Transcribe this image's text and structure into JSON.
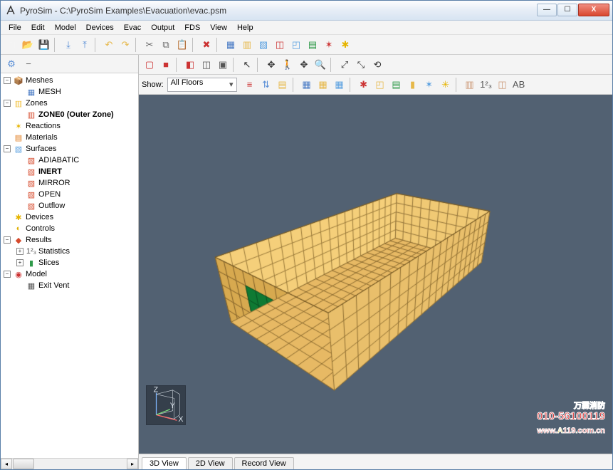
{
  "window": {
    "title": "PyroSim - C:\\PyroSim Examples\\Evacuation\\evac.psm",
    "buttons": {
      "min": "—",
      "max": "☐",
      "close": "X"
    }
  },
  "menu": [
    "File",
    "Edit",
    "Model",
    "Devices",
    "Evac",
    "Output",
    "FDS",
    "View",
    "Help"
  ],
  "toolbar_main": [
    {
      "name": "new-icon"
    },
    {
      "name": "open-icon"
    },
    {
      "name": "save-icon"
    },
    {
      "sep": true
    },
    {
      "name": "import-icon"
    },
    {
      "name": "export-icon"
    },
    {
      "sep": true
    },
    {
      "name": "undo-icon"
    },
    {
      "name": "redo-icon"
    },
    {
      "sep": true
    },
    {
      "name": "cut-icon"
    },
    {
      "name": "copy-icon"
    },
    {
      "name": "paste-icon"
    },
    {
      "sep": true
    },
    {
      "name": "delete-icon"
    },
    {
      "sep": true
    },
    {
      "name": "new-mesh-icon"
    },
    {
      "name": "new-zone-icon"
    },
    {
      "name": "new-surface-icon"
    },
    {
      "name": "new-obstruction-icon"
    },
    {
      "name": "new-hole-icon"
    },
    {
      "name": "new-vent-icon"
    },
    {
      "name": "new-particle-icon"
    },
    {
      "name": "new-device-icon"
    }
  ],
  "leftpane_toolbar": [
    {
      "name": "settings-icon"
    },
    {
      "name": "collapse-icon"
    }
  ],
  "tree": [
    {
      "depth": 0,
      "exp": "-",
      "icon": "📦",
      "color": "#4b7cc5",
      "label": "Meshes"
    },
    {
      "depth": 1,
      "exp": "",
      "icon": "▦",
      "color": "#4b7cc5",
      "label": "MESH"
    },
    {
      "depth": 0,
      "exp": "-",
      "icon": "▥",
      "color": "#f2c241",
      "label": "Zones"
    },
    {
      "depth": 1,
      "exp": "",
      "icon": "▥",
      "color": "#d64a2c",
      "label": "ZONE0 (Outer Zone)",
      "bold": true
    },
    {
      "depth": 0,
      "exp": "",
      "icon": "✶",
      "color": "#e6b400",
      "label": "Reactions"
    },
    {
      "depth": 0,
      "exp": "",
      "icon": "▤",
      "color": "#e07a1b",
      "label": "Materials"
    },
    {
      "depth": 0,
      "exp": "-",
      "icon": "▧",
      "color": "#5aa0e0",
      "label": "Surfaces"
    },
    {
      "depth": 1,
      "exp": "",
      "icon": "▧",
      "color": "#d64a2c",
      "label": "ADIABATIC"
    },
    {
      "depth": 1,
      "exp": "",
      "icon": "▧",
      "color": "#d64a2c",
      "label": "INERT",
      "bold": true
    },
    {
      "depth": 1,
      "exp": "",
      "icon": "▧",
      "color": "#d64a2c",
      "label": "MIRROR"
    },
    {
      "depth": 1,
      "exp": "",
      "icon": "▧",
      "color": "#d64a2c",
      "label": "OPEN"
    },
    {
      "depth": 1,
      "exp": "",
      "icon": "▧",
      "color": "#d64a2c",
      "label": "Outflow"
    },
    {
      "depth": 0,
      "exp": "",
      "icon": "✱",
      "color": "#e6b400",
      "label": "Devices"
    },
    {
      "depth": 0,
      "exp": "",
      "icon": "◐",
      "color": "#e0b000",
      "label": "Controls"
    },
    {
      "depth": 0,
      "exp": "-",
      "icon": "◆",
      "color": "#d64a2c",
      "label": "Results"
    },
    {
      "depth": 1,
      "exp": "+",
      "icon": "1²₃",
      "color": "#555",
      "label": "Statistics"
    },
    {
      "depth": 1,
      "exp": "+",
      "icon": "▮",
      "color": "#2f9a4a",
      "label": "Slices"
    },
    {
      "depth": 0,
      "exp": "-",
      "icon": "◉",
      "color": "#c33",
      "label": "Model"
    },
    {
      "depth": 1,
      "exp": "",
      "icon": "▦",
      "color": "#555",
      "label": "Exit Vent"
    }
  ],
  "viewport_toolbar1": [
    {
      "name": "wireframe-icon"
    },
    {
      "name": "solid-icon"
    },
    {
      "sep": true
    },
    {
      "name": "mixed-icon"
    },
    {
      "name": "outline-icon"
    },
    {
      "name": "realistic-icon"
    },
    {
      "sep": true
    },
    {
      "name": "select-icon"
    },
    {
      "sep": true
    },
    {
      "name": "orbit-icon"
    },
    {
      "name": "walk-icon"
    },
    {
      "name": "pan-icon"
    },
    {
      "name": "zoom-icon"
    },
    {
      "sep": true
    },
    {
      "name": "zoom-extents-icon"
    },
    {
      "name": "zoom-selection-icon"
    },
    {
      "name": "reset-view-icon"
    }
  ],
  "show_label": "Show:",
  "floor_selected": "All Floors",
  "viewport_toolbar2": [
    {
      "name": "floor-down-icon"
    },
    {
      "name": "floor-up-icon"
    },
    {
      "name": "floor-settings-icon"
    },
    {
      "sep": true
    },
    {
      "name": "show-mesh-icon"
    },
    {
      "name": "show-mesh-boundary-icon"
    },
    {
      "name": "show-mesh-grid-icon"
    },
    {
      "sep": true
    },
    {
      "name": "show-obstructions-icon"
    },
    {
      "name": "show-holes-icon"
    },
    {
      "name": "show-vents-icon"
    },
    {
      "name": "show-slices-icon"
    },
    {
      "name": "show-devices-icon"
    },
    {
      "name": "show-evac-icon"
    },
    {
      "sep": true
    },
    {
      "name": "show-labels-icon"
    },
    {
      "name": "show-stats-icon"
    },
    {
      "name": "show-model-icon"
    },
    {
      "name": "show-notes-icon"
    }
  ],
  "axes": {
    "x": "X",
    "y": "Y",
    "z": "Z"
  },
  "watermark": {
    "line1": "万霖消防",
    "line2": "010-56100119",
    "line3": "www.A119.com.cn"
  },
  "tabs": [
    {
      "label": "3D View",
      "active": true
    },
    {
      "label": "2D View",
      "active": false
    },
    {
      "label": "Record View",
      "active": false
    }
  ]
}
